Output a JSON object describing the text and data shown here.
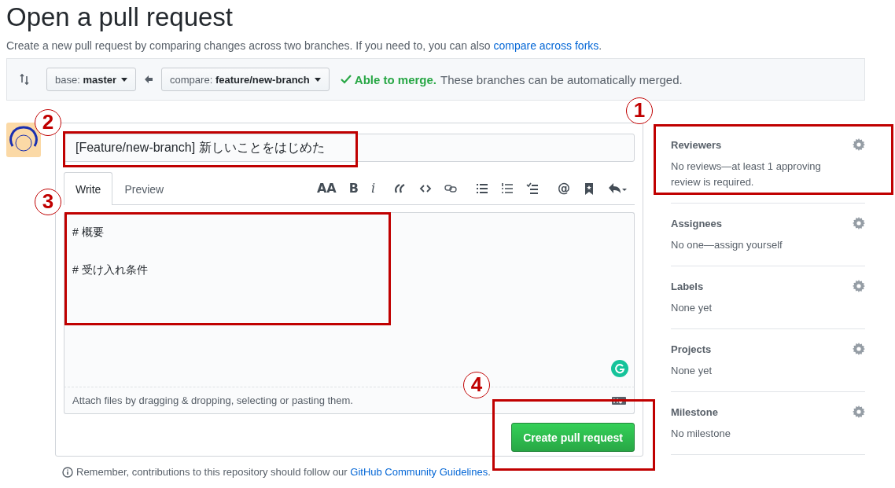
{
  "page": {
    "title": "Open a pull request",
    "subtitle": "Create a new pull request by comparing changes across two branches. If you need to, you can also ",
    "subtitle_link": "compare across forks",
    "subtitle_end": "."
  },
  "compare_bar": {
    "base": "base: **master**",
    "compare": "compare: **feature/new-branch**",
    "status": "Able to merge.",
    "status_text": "These branches can be automatically merged."
  },
  "form": {
    "title_value": "[Feature/new-branch] 新しいことをはじめた",
    "tabs": [
      {
        "label": "Write",
        "selected": true
      },
      {
        "label": "Preview",
        "selected": false
      }
    ],
    "toolbar": [
      [
        {
          "kind": "text",
          "label": "AA"
        },
        {
          "kind": "text",
          "label": "B"
        },
        {
          "kind": "italic",
          "label": "i"
        }
      ],
      [
        {
          "kind": "quote"
        },
        {
          "kind": "code"
        },
        {
          "kind": "link"
        }
      ],
      [
        {
          "kind": "bullets"
        },
        {
          "kind": "numbers"
        },
        {
          "kind": "tasks"
        }
      ],
      [
        {
          "kind": "text",
          "label": "@"
        },
        {
          "kind": "bookmark"
        },
        {
          "kind": "reply"
        }
      ]
    ],
    "body": "# 概要\n\n# 受け入れ条件",
    "attach": "Attach files by dragging & dropping, selecting or pasting them.",
    "submit": "Create pull request"
  },
  "footer": {
    "text": "Remember, contributions to this repository should follow our ",
    "link": "GitHub Community Guidelines",
    "end": "."
  },
  "sidebar": [
    {
      "title": "Reviewers",
      "text": "No reviews—at least 1 approving review is required."
    },
    {
      "title": "Assignees",
      "text": "No one—assign yourself"
    },
    {
      "title": "Labels",
      "text": "None yet"
    },
    {
      "title": "Projects",
      "text": "None yet"
    },
    {
      "title": "Milestone",
      "text": "No milestone"
    }
  ],
  "annotations": [
    {
      "number": "1"
    },
    {
      "number": "2"
    },
    {
      "number": "3"
    },
    {
      "number": "4"
    }
  ]
}
